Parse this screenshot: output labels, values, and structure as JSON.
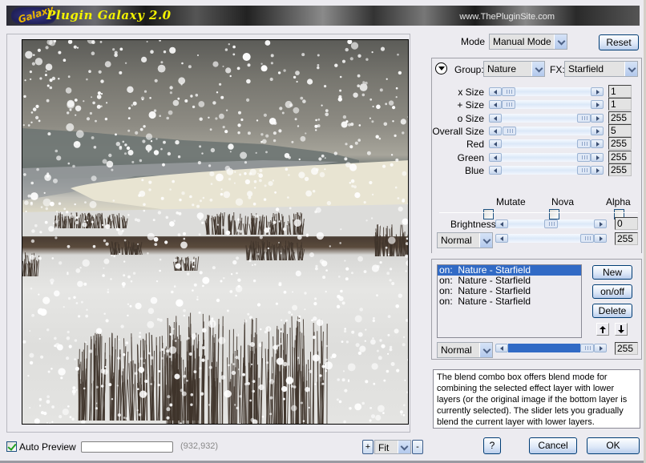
{
  "banner": {
    "logo_text": "Galaxy",
    "title": "Plugin Galaxy 2.0",
    "website": "www.ThePluginSite.com"
  },
  "preview": {
    "auto_preview_label": "Auto Preview",
    "auto_preview_checked": true,
    "progress": 0,
    "image_dimensions": "(932,932)",
    "zoom_in_label": "+",
    "zoom_out_label": "-",
    "zoom_value": "Fit"
  },
  "mode": {
    "label": "Mode",
    "value": "Manual Mode",
    "reset_label": "Reset"
  },
  "effect": {
    "group_label": "Group:",
    "group_value": "Nature",
    "fx_label": "FX:",
    "fx_value": "Starfield",
    "params": [
      {
        "label": "x Size",
        "value": "1",
        "min": 1,
        "max": 255
      },
      {
        "label": "+ Size",
        "value": "1",
        "min": 1,
        "max": 255
      },
      {
        "label": "o Size",
        "value": "255",
        "min": 1,
        "max": 255
      },
      {
        "label": "Overall Size",
        "value": "5",
        "min": 1,
        "max": 255
      },
      {
        "label": "Red",
        "value": "255",
        "min": 0,
        "max": 255
      },
      {
        "label": "Green",
        "value": "255",
        "min": 0,
        "max": 255
      },
      {
        "label": "Blue",
        "value": "255",
        "min": 0,
        "max": 255
      }
    ],
    "checkboxes": [
      {
        "label": "Mutate",
        "checked": false
      },
      {
        "label": "Nova",
        "checked": false
      },
      {
        "label": "Alpha",
        "checked": false
      }
    ],
    "brightness": {
      "label": "Brightness",
      "value": "0",
      "min": -255,
      "max": 255
    },
    "blend": {
      "mode": "Normal",
      "value": "255",
      "max": 255
    }
  },
  "layers": {
    "items": [
      {
        "text": "on:  Nature - Starfield",
        "selected": true
      },
      {
        "text": "on:  Nature - Starfield",
        "selected": false
      },
      {
        "text": "on:  Nature - Starfield",
        "selected": false
      },
      {
        "text": "on:  Nature - Starfield",
        "selected": false
      }
    ],
    "new_label": "New",
    "onoff_label": "on/off",
    "delete_label": "Delete",
    "blend": {
      "mode": "Normal",
      "value": "255",
      "max": 255
    }
  },
  "help": {
    "text": "The blend combo box offers blend mode for combining the selected effect layer with lower layers (or the original image if the bottom layer is currently selected). The slider lets you gradually blend the current layer with lower layers.",
    "checked": true
  },
  "dialog": {
    "help_label": "?",
    "cancel_label": "Cancel",
    "ok_label": "OK"
  }
}
